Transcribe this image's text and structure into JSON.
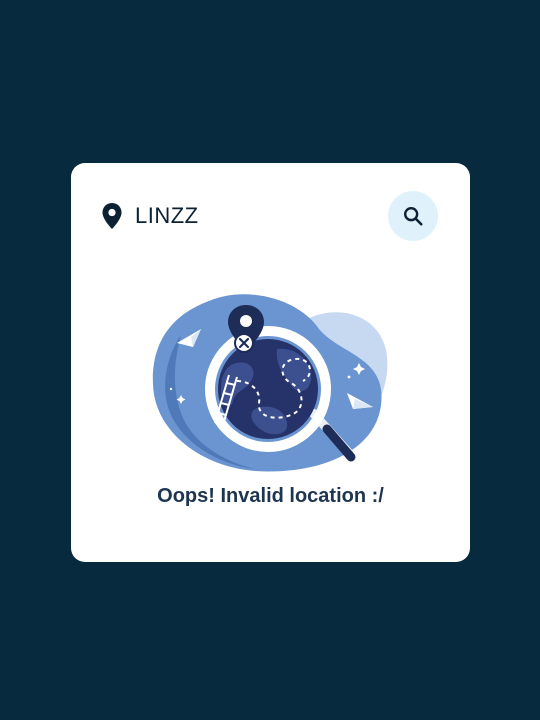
{
  "search": {
    "value": "LINZZ",
    "icon": "location-pin-icon",
    "button_icon": "search-icon"
  },
  "error": {
    "message": "Oops! Invalid location :/",
    "illustration": "globe-magnifier-not-found-illustration"
  },
  "colors": {
    "background": "#072a3f",
    "card": "#ffffff",
    "text": "#0c2131",
    "search_button_bg": "#dff1fb",
    "illustration_blue": "#5b86c6",
    "illustration_dark": "#1e2c58"
  }
}
